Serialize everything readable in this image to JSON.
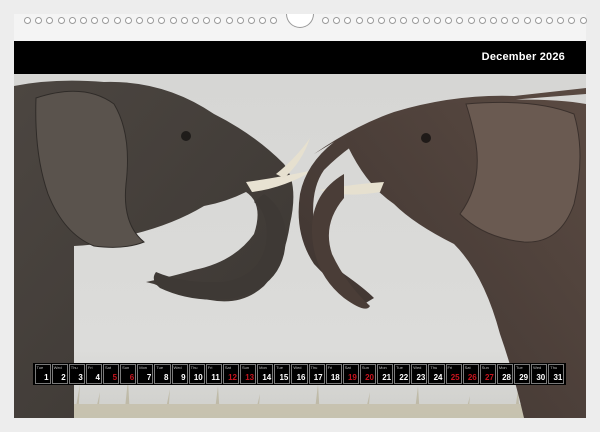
{
  "calendar": {
    "month_label": "December 2026",
    "days": [
      {
        "wd": "Tue",
        "num": "1",
        "weekend": false
      },
      {
        "wd": "Wed",
        "num": "2",
        "weekend": false
      },
      {
        "wd": "Thu",
        "num": "3",
        "weekend": false
      },
      {
        "wd": "Fri",
        "num": "4",
        "weekend": false
      },
      {
        "wd": "Sat",
        "num": "5",
        "weekend": true
      },
      {
        "wd": "Sun",
        "num": "6",
        "weekend": true
      },
      {
        "wd": "Mon",
        "num": "7",
        "weekend": false
      },
      {
        "wd": "Tue",
        "num": "8",
        "weekend": false
      },
      {
        "wd": "Wed",
        "num": "9",
        "weekend": false
      },
      {
        "wd": "Thu",
        "num": "10",
        "weekend": false
      },
      {
        "wd": "Fri",
        "num": "11",
        "weekend": false
      },
      {
        "wd": "Sat",
        "num": "12",
        "weekend": true
      },
      {
        "wd": "Sun",
        "num": "13",
        "weekend": true
      },
      {
        "wd": "Mon",
        "num": "14",
        "weekend": false
      },
      {
        "wd": "Tue",
        "num": "15",
        "weekend": false
      },
      {
        "wd": "Wed",
        "num": "16",
        "weekend": false
      },
      {
        "wd": "Thu",
        "num": "17",
        "weekend": false
      },
      {
        "wd": "Fri",
        "num": "18",
        "weekend": false
      },
      {
        "wd": "Sat",
        "num": "19",
        "weekend": true
      },
      {
        "wd": "Sun",
        "num": "20",
        "weekend": true
      },
      {
        "wd": "Mon",
        "num": "21",
        "weekend": false
      },
      {
        "wd": "Tue",
        "num": "22",
        "weekend": false
      },
      {
        "wd": "Wed",
        "num": "23",
        "weekend": false
      },
      {
        "wd": "Thu",
        "num": "24",
        "weekend": false
      },
      {
        "wd": "Fri",
        "num": "25",
        "weekend": true
      },
      {
        "wd": "Sat",
        "num": "26",
        "weekend": true
      },
      {
        "wd": "Sun",
        "num": "27",
        "weekend": true
      },
      {
        "wd": "Mon",
        "num": "28",
        "weekend": false
      },
      {
        "wd": "Tue",
        "num": "29",
        "weekend": false
      },
      {
        "wd": "Wed",
        "num": "30",
        "weekend": false
      },
      {
        "wd": "Thu",
        "num": "31",
        "weekend": false
      }
    ]
  },
  "colors": {
    "header_bg": "#000000",
    "header_text": "#ffffff",
    "weekend_number": "#c8141e",
    "weekday_number": "#ffffff"
  },
  "photo": {
    "subject": "two elephants intertwining trunks"
  }
}
